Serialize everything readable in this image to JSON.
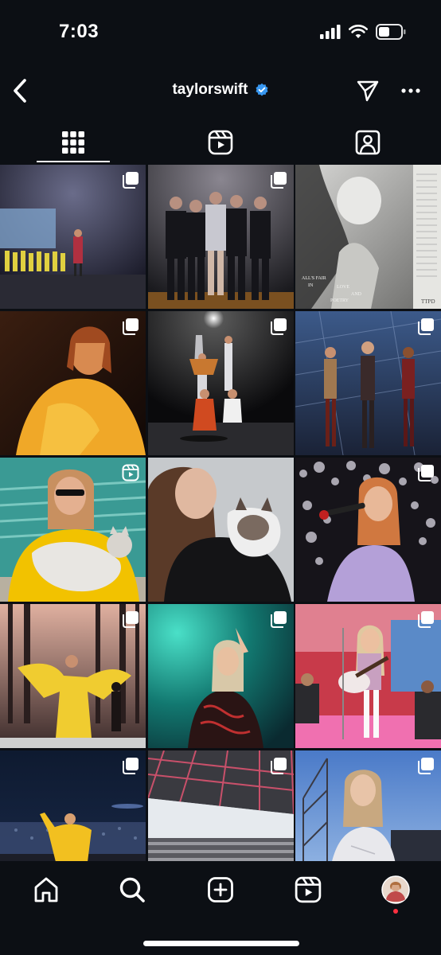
{
  "status_bar": {
    "time": "7:03",
    "icons": [
      "signal-icon",
      "wifi-icon",
      "battery-icon"
    ]
  },
  "header": {
    "username": "taylorswift",
    "verified": true,
    "icons": [
      "back-arrow-icon",
      "verified-badge-icon",
      "send-icon",
      "more-icon"
    ]
  },
  "tabs": [
    {
      "name": "posts-grid",
      "icon": "grid-icon",
      "selected": true
    },
    {
      "name": "reels",
      "icon": "reels-icon",
      "selected": false
    },
    {
      "name": "tagged",
      "icon": "tagged-person-icon",
      "selected": false
    }
  ],
  "posts": [
    {
      "badge": "carousel-icon",
      "scene": "stadium stage with performers"
    },
    {
      "badge": "carousel-icon",
      "scene": "group photo with dancers"
    },
    {
      "badge": "none",
      "scene": "album cover",
      "caption_lines": [
        "ALL'S FAIR",
        "IN",
        "LOVE",
        "AND",
        "POETRY"
      ],
      "corner_text": "TTPD"
    },
    {
      "badge": "carousel-icon",
      "scene": "yellow dress portrait"
    },
    {
      "badge": "carousel-icon",
      "scene": "stage with guitarists"
    },
    {
      "badge": "carousel-icon",
      "scene": "three performers on stage"
    },
    {
      "badge": "reels-icon",
      "scene": "yellow sweater with cat"
    },
    {
      "badge": "none",
      "scene": "portrait with cat"
    },
    {
      "badge": "carousel-icon",
      "scene": "singing with microphone"
    },
    {
      "badge": "carousel-icon",
      "scene": "yellow dress forest stage"
    },
    {
      "badge": "carousel-icon",
      "scene": "teal background performer"
    },
    {
      "badge": "carousel-icon",
      "scene": "guitar on pink stage"
    },
    {
      "badge": "carousel-icon",
      "scene": "yellow dress arena"
    },
    {
      "badge": "carousel-icon",
      "scene": "stadium roof crowd"
    },
    {
      "badge": "carousel-icon",
      "scene": "white jacket outdoor stage"
    }
  ],
  "bottom_nav": [
    {
      "name": "home",
      "icon": "home-icon"
    },
    {
      "name": "search",
      "icon": "search-icon"
    },
    {
      "name": "create",
      "icon": "add-post-icon"
    },
    {
      "name": "reels",
      "icon": "reels-icon"
    },
    {
      "name": "profile",
      "icon": "profile-avatar"
    }
  ],
  "colors": {
    "background": "#0c0f14",
    "verified": "#3897f0",
    "notification_dot": "#ff3040",
    "foreground": "#ffffff"
  }
}
